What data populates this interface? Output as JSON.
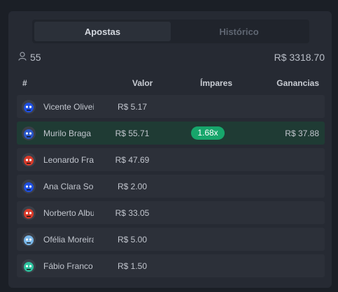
{
  "tabs": [
    {
      "label": "Apostas",
      "active": true
    },
    {
      "label": "Histórico",
      "active": false
    }
  ],
  "summary": {
    "players_count": "55",
    "total_amount": "R$ 3318.70"
  },
  "columns": {
    "index": "#",
    "value": "Valor",
    "odds": "Ímpares",
    "winnings": "Ganancias"
  },
  "bets": [
    {
      "name": "Vicente Oliveira",
      "value": "R$ 5.17",
      "odds": "",
      "winnings": "",
      "avatar_icon": "blue-monster-avatar-icon",
      "avatar_color": "#1e4fe0"
    },
    {
      "name": "Murilo Braga",
      "value": "R$ 55.71",
      "odds": "1.68x",
      "winnings": "R$ 37.88",
      "avatar_icon": "white-robot-avatar-icon",
      "avatar_color": "#2a57c9"
    },
    {
      "name": "Leonardo Fraga",
      "value": "R$ 47.69",
      "odds": "",
      "winnings": "",
      "avatar_icon": "red-monster-avatar-icon",
      "avatar_color": "#d93b2b"
    },
    {
      "name": "Ana Clara Souza",
      "value": "R$ 2.00",
      "odds": "",
      "winnings": "",
      "avatar_icon": "blue-monster-avatar-icon",
      "avatar_color": "#1e4fe0"
    },
    {
      "name": "Norberto Albuquerque",
      "value": "R$ 33.05",
      "odds": "",
      "winnings": "",
      "avatar_icon": "red-monster-avatar-icon",
      "avatar_color": "#d93b2b"
    },
    {
      "name": "Ofélia Moreira",
      "value": "R$ 5.00",
      "odds": "",
      "winnings": "",
      "avatar_icon": "lightblue-monster-avatar-icon",
      "avatar_color": "#79b6e8"
    },
    {
      "name": "Fábio Franco",
      "value": "R$ 1.50",
      "odds": "",
      "winnings": "",
      "avatar_icon": "green-monster-avatar-icon",
      "avatar_color": "#2ec4a0"
    }
  ]
}
